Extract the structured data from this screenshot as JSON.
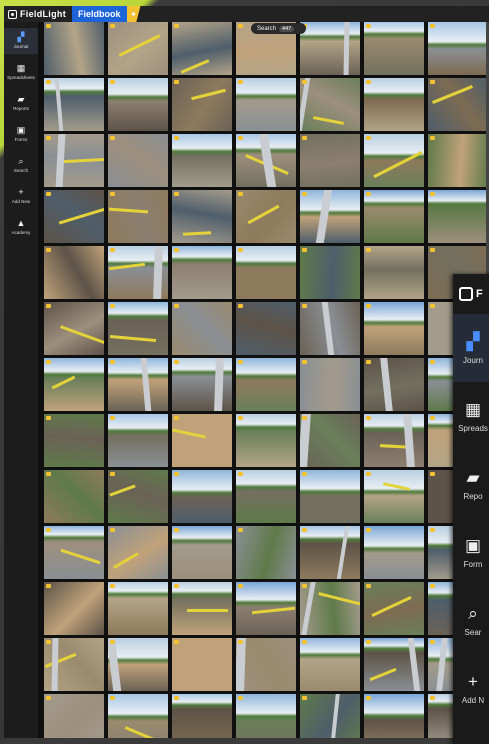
{
  "app": {
    "brand": "FieldLight",
    "tab": "Fieldbook"
  },
  "search": {
    "label": "Search",
    "count": "447"
  },
  "sidebar": {
    "items": [
      {
        "label": "Journal",
        "icon": "journal-icon",
        "glyph": "▞",
        "active": true
      },
      {
        "label": "Spreadsheets",
        "icon": "spreadsheet-icon",
        "glyph": "▦",
        "active": false
      },
      {
        "label": "Reports",
        "icon": "report-icon",
        "glyph": "▰",
        "active": false
      },
      {
        "label": "Forms",
        "icon": "forms-icon",
        "glyph": "▣",
        "active": false
      },
      {
        "label": "Search",
        "icon": "search-icon",
        "glyph": "⌕",
        "active": false
      },
      {
        "label": "Add New",
        "icon": "plus-icon",
        "glyph": "+",
        "active": false
      },
      {
        "label": "Academy",
        "icon": "graduation-cap-icon",
        "glyph": "▲",
        "active": false
      }
    ]
  },
  "overlay": {
    "brand": "F",
    "items": [
      {
        "label": "Journ",
        "icon": "journal-icon",
        "glyph": "▞",
        "active": true
      },
      {
        "label": "Spreads",
        "icon": "spreadsheet-icon",
        "glyph": "▦",
        "active": false
      },
      {
        "label": "Repo",
        "icon": "report-icon",
        "glyph": "▰",
        "active": false
      },
      {
        "label": "Form",
        "icon": "forms-icon",
        "glyph": "▣",
        "active": false
      },
      {
        "label": "Sear",
        "icon": "search-icon",
        "glyph": "⌕",
        "active": false
      },
      {
        "label": "Add N",
        "icon": "plus-icon",
        "glyph": "+",
        "active": false
      }
    ]
  },
  "photos": {
    "rows": 13,
    "cols": 7,
    "palette": [
      "#7d6b52",
      "#8a8f94",
      "#5f7a4a",
      "#9a8a6e",
      "#6b6256",
      "#8e7a5d",
      "#a39b8c",
      "#4f5e6b",
      "#b3a488",
      "#73705f",
      "#c0a27a",
      "#6a7f5a",
      "#8c7f70",
      "#9d8f7d",
      "#5d5348"
    ],
    "skies": [
      "#8fb6dc",
      "#a7c7e6",
      "#7aa6d6",
      "#b9cfe2"
    ]
  }
}
